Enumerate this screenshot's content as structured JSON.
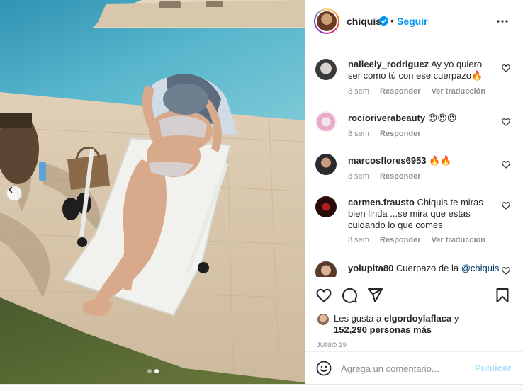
{
  "header": {
    "username": "chiquis",
    "separator": "•",
    "follow_label": "Seguir",
    "more_icon": "more-horizontal-icon"
  },
  "comments": [
    {
      "username": "nalleely_rodriguez",
      "text": "Ay yo quiero ser como tú con ese cuerpazo🔥",
      "time": "8 sem",
      "reply": "Responder",
      "translate": "Ver traducción"
    },
    {
      "username": "rocioriverabeauty",
      "text": "😍😍😍",
      "time": "8 sem",
      "reply": "Responder"
    },
    {
      "username": "marcosflores6953",
      "text": "🔥🔥",
      "time": "8 sem",
      "reply": "Responder"
    },
    {
      "username": "carmen.frausto",
      "text": "Chiquis te miras bien linda ...se mira que estas cuidando lo que comes",
      "time": "8 sem",
      "reply": "Responder",
      "translate": "Ver traducción"
    },
    {
      "username": "yolupita80",
      "text": "Cuerpazo de la",
      "mention": "@chiquis"
    }
  ],
  "actions": {
    "like_icon": "heart-icon",
    "comment_icon": "comment-icon",
    "share_icon": "send-icon",
    "save_icon": "bookmark-icon"
  },
  "likes": {
    "prefix": "Les gusta a",
    "user": "elgordoylaflaca",
    "joiner": "y",
    "count": "152,290 personas más"
  },
  "date": "JUNIO 29",
  "add_comment": {
    "placeholder": "Agrega un comentario...",
    "post_label": "Publicar",
    "emoji_icon": "emoji-smile-icon"
  },
  "carousel": {
    "total_slides": 2,
    "active_slide": 2
  },
  "colors": {
    "accent": "#0095f6",
    "post_disabled": "#b2dffc",
    "muted": "#8e8e8e",
    "text": "#262626"
  }
}
